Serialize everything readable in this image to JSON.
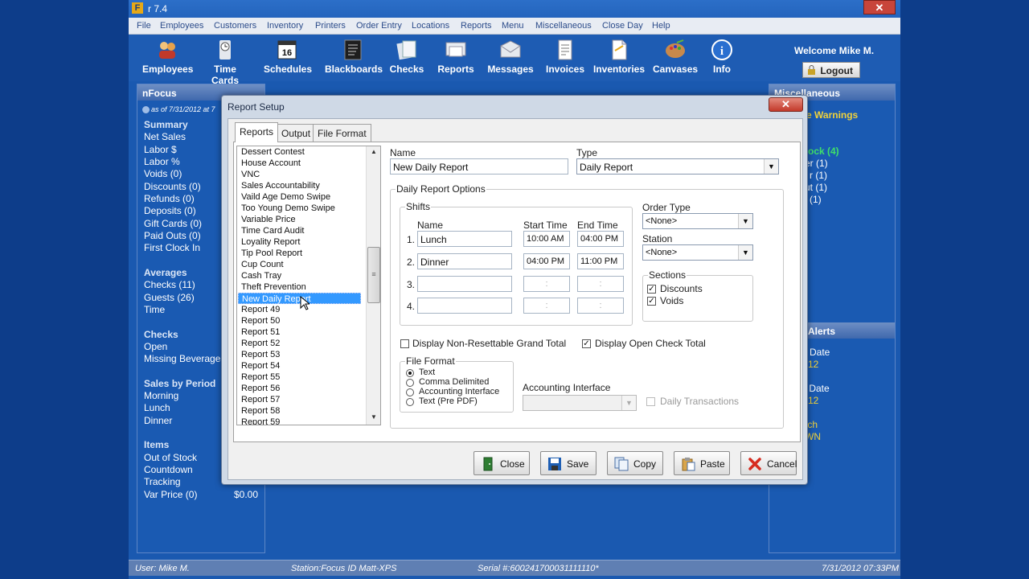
{
  "app": {
    "title": "r 7.4",
    "logo": "F",
    "close_glyph": "✕"
  },
  "menu": [
    "File",
    "Employees",
    "Customers",
    "Inventory",
    "Printers",
    "Order Entry",
    "Locations",
    "Reports",
    "Menu",
    "Miscellaneous",
    "Close Day",
    "Help"
  ],
  "toolbar": {
    "buttons": [
      {
        "label": "Employees",
        "icon": "employees-icon"
      },
      {
        "label": "Time Cards",
        "icon": "time-cards-icon"
      },
      {
        "label": "Schedules",
        "icon": "calendar-icon",
        "badge": "16"
      },
      {
        "label": "Blackboards",
        "icon": "blackboard-icon"
      },
      {
        "label": "Checks",
        "icon": "checks-icon"
      },
      {
        "label": "Reports",
        "icon": "reports-icon"
      },
      {
        "label": "Messages",
        "icon": "messages-icon"
      },
      {
        "label": "Invoices",
        "icon": "invoice-icon"
      },
      {
        "label": "Inventories",
        "icon": "inventories-icon"
      },
      {
        "label": "Canvases",
        "icon": "canvas-icon"
      },
      {
        "label": "Info",
        "icon": "info-icon"
      }
    ],
    "welcome": "Welcome Mike M.",
    "logout": "Logout"
  },
  "left_panel": {
    "title": "nFocus",
    "as_of": "as of 7/31/2012 at 7",
    "summary_head": "Summary",
    "summary": [
      "Net Sales",
      "Labor $",
      "Labor %",
      "Voids (0)",
      "Discounts (0)",
      "Refunds (0)",
      "Deposits (0)",
      "Gift Cards (0)",
      "Paid Outs (0)",
      "First Clock In"
    ],
    "averages_head": "Averages",
    "averages": [
      "Checks (11)",
      "Guests (26)",
      "Time"
    ],
    "checks_head": "Checks",
    "checks": [
      "Open",
      "Missing Beverages"
    ],
    "period_head": "Sales by Period",
    "period": [
      "Morning",
      "Lunch",
      "Dinner"
    ],
    "items_head": "Items",
    "items": [
      "Out of Stock",
      "Countdown",
      "Tracking",
      "Var Price (0)"
    ],
    "var_price_value": "$0.00"
  },
  "right_panel": {
    "title": "Miscellaneous",
    "warnings": "e Warnings",
    "lines": [
      "ock (4)",
      "er (1)",
      "r (1)",
      "ut (1)",
      "(1)"
    ],
    "alerts_title": "Alerts",
    "alert_lines": [
      "Date",
      "12",
      "s Date",
      "12",
      "tch",
      "WN"
    ]
  },
  "status": {
    "user": "User: Mike M.",
    "station": "Station:Focus ID Matt-XPS",
    "serial": "Serial #:600241700031111110*",
    "datetime": "7/31/2012 07:33PM"
  },
  "dialog": {
    "title": "Report Setup",
    "close_glyph": "✕",
    "tabs": [
      "Reports",
      "Output",
      "File Format"
    ],
    "report_list": [
      "Dessert Contest",
      "House Account",
      "VNC",
      "Sales Accountability",
      "Vaild Age Demo Swipe",
      "Too Young Demo Swipe",
      "Variable Price",
      "Time Card Audit",
      "Loyality Report",
      "Tip Pool Report",
      "Cup Count",
      "Cash Tray",
      "Theft Prevention",
      "New Daily Report",
      "Report 49",
      "Report 50",
      "Report 51",
      "Report 52",
      "Report 53",
      "Report 54",
      "Report 55",
      "Report 56",
      "Report 57",
      "Report 58",
      "Report 59"
    ],
    "selected_report": "New Daily Report",
    "name_label": "Name",
    "name_value": "New Daily Report",
    "type_label": "Type",
    "type_value": "Daily Report",
    "options_label": "Daily Report Options",
    "shifts_label": "Shifts",
    "col_name": "Name",
    "col_start": "Start Time",
    "col_end": "End Time",
    "shifts": [
      {
        "num": "1.",
        "name": "Lunch",
        "start": "10:00 AM",
        "end": "04:00 PM"
      },
      {
        "num": "2.",
        "name": "Dinner",
        "start": "04:00 PM",
        "end": "11:00 PM"
      },
      {
        "num": "3.",
        "name": "",
        "start": ":",
        "end": ":"
      },
      {
        "num": "4.",
        "name": "",
        "start": ":",
        "end": ":"
      }
    ],
    "order_type_label": "Order Type",
    "order_type_value": "<None>",
    "station_label": "Station",
    "station_value": "<None>",
    "sections_label": "Sections",
    "sections": [
      {
        "label": "Discounts",
        "checked": true
      },
      {
        "label": "Voids",
        "checked": true
      }
    ],
    "non_resettable": "Display Non-Resettable Grand Total",
    "open_check": "Display Open Check Total",
    "file_format_label": "File Format",
    "file_formats": [
      "Text",
      "Comma Delimited",
      "Accounting Interface",
      "Text (Pre PDF)"
    ],
    "selected_format": "Text",
    "accounting_label": "Accounting Interface",
    "daily_transactions": "Daily Transactions",
    "buttons": [
      "Close",
      "Save",
      "Copy",
      "Paste",
      "Cancel"
    ]
  }
}
